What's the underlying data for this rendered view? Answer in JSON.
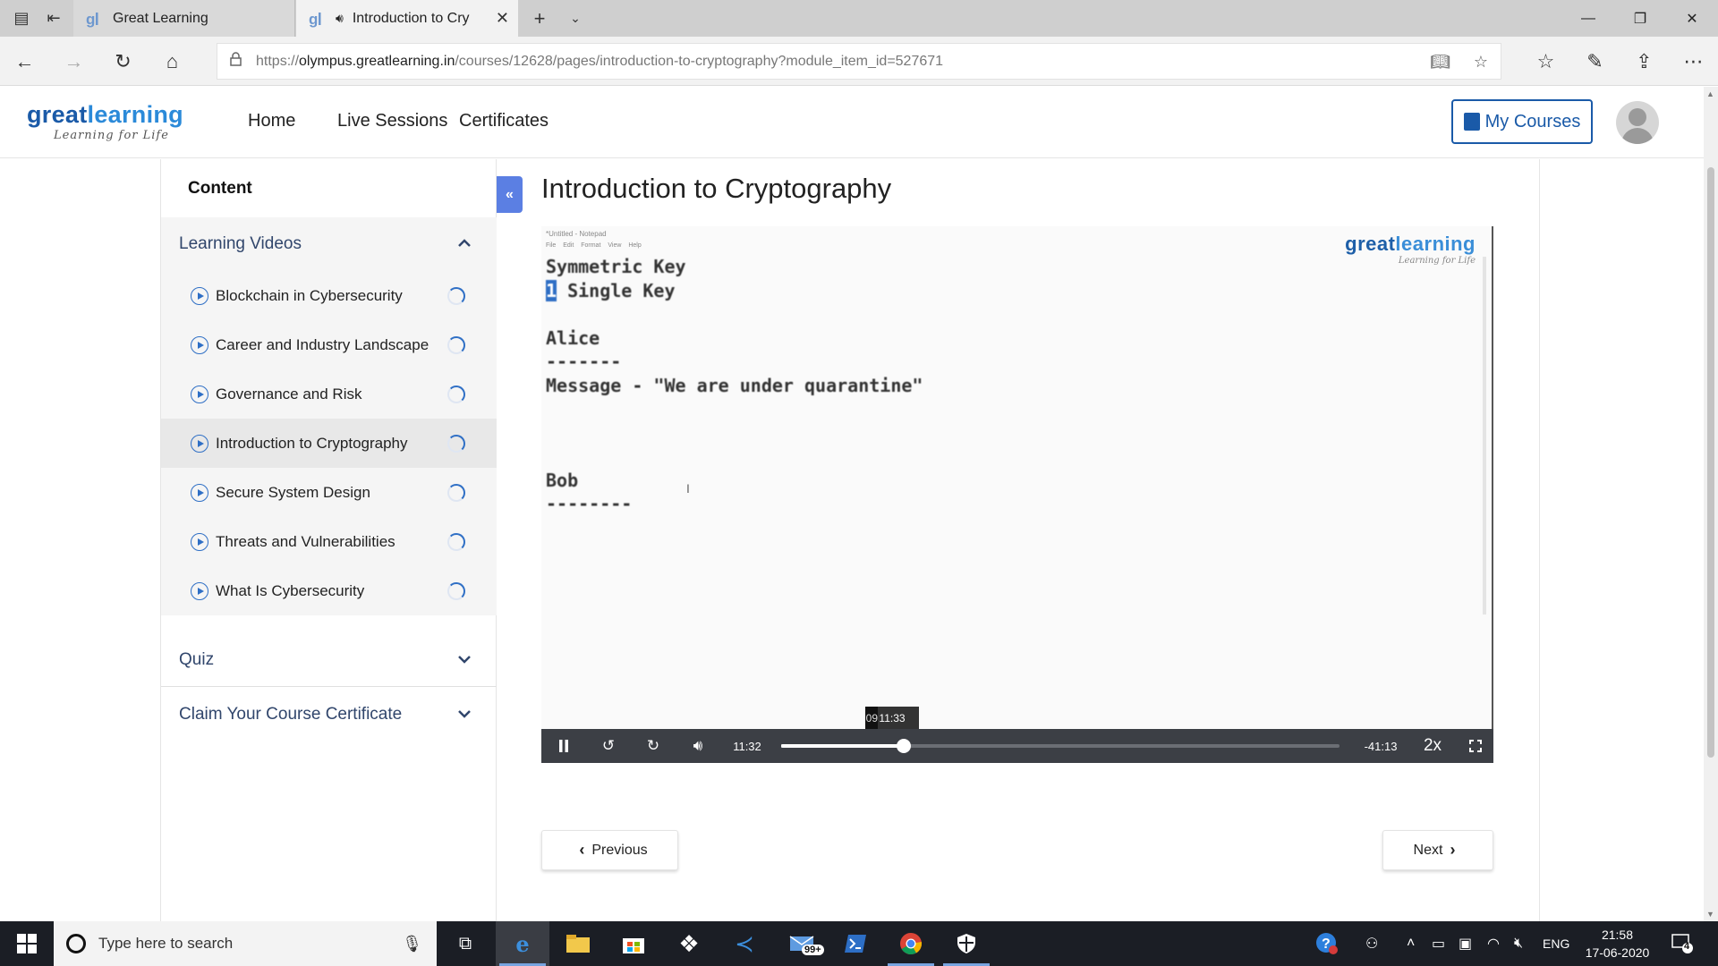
{
  "browser": {
    "tabs": [
      {
        "title": "Great Learning",
        "favicon": "great-learning-favicon"
      },
      {
        "title": "Introduction to Cry",
        "favicon": "great-learning-favicon",
        "audio": true
      }
    ],
    "url": {
      "prefix": "https://",
      "host": "olympus.greatlearning.in",
      "path": "/courses/12628/pages/introduction-to-cryptography?module_item_id=527671"
    }
  },
  "site": {
    "logo": {
      "great": "great",
      "learning": "learning",
      "tagline": "Learning for Life"
    },
    "nav": [
      "Home",
      "Live Sessions",
      "Certificates"
    ],
    "my_courses": "My Courses"
  },
  "sidebar": {
    "header": "Content",
    "learning_videos": "Learning Videos",
    "videos": [
      {
        "title": "Blockchain in Cybersecurity",
        "active": false
      },
      {
        "title": "Career and Industry Landscape",
        "active": false
      },
      {
        "title": "Governance and Risk",
        "active": false
      },
      {
        "title": "Introduction to Cryptography",
        "active": true
      },
      {
        "title": "Secure System Design",
        "active": false
      },
      {
        "title": "Threats and Vulnerabilities",
        "active": false
      },
      {
        "title": "What Is Cybersecurity",
        "active": false
      }
    ],
    "quiz": "Quiz",
    "certificate": "Claim Your Course Certificate"
  },
  "page": {
    "title": "Introduction to Cryptography",
    "previous": "Previous",
    "next": "Next"
  },
  "video": {
    "notepad_title": "*Untitled - Notepad",
    "notepad_menu": "File Edit Format View Help",
    "lines": {
      "l1": "Symmetric Key",
      "l2a": "1",
      "l2b": " Single Key",
      "l3": "",
      "l4": "Alice",
      "l5": "-------",
      "l6": "Message - \"We are under quarantine\"",
      "l7": "",
      "l8": "",
      "l9": "",
      "l10": "Bob",
      "l11": "--------"
    },
    "watermark": {
      "great": "great",
      "learning": "learning",
      "tagline": "Learning for Life"
    },
    "tooltip": "11:33",
    "tooltip_prev": "09",
    "current_time": "11:32",
    "remaining_time": "-41:13",
    "speed": "2x",
    "progress_fraction": 0.22,
    "buffered_fraction": 0.2
  },
  "taskbar": {
    "search_placeholder": "Type here to search",
    "mail_badge": "99+",
    "language": "ENG",
    "time": "21:58",
    "date": "17-06-2020",
    "notifications": "4"
  },
  "colors": {
    "accent": "#1a5aa8",
    "sidebar_bg": "#f5f5f5",
    "player_bar": "#3c3f45"
  }
}
